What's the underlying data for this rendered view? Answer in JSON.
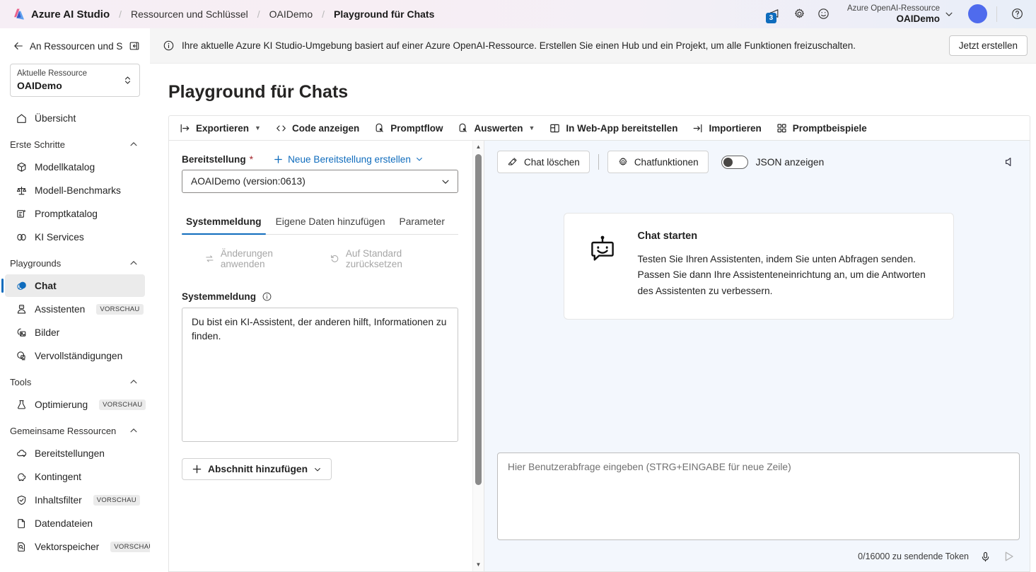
{
  "header": {
    "brand": "Azure AI Studio",
    "breadcrumbs": [
      "Ressourcen und Schlüssel",
      "OAIDemo",
      "Playground für Chats"
    ],
    "notification_badge": "3",
    "resource_kind": "Azure OpenAI-Ressource",
    "resource_name": "OAIDemo",
    "icons": {
      "megaphone": "megaphone-icon",
      "gear": "gear-icon",
      "feedback": "smiley-icon",
      "chevron": "chevron-down-icon",
      "help": "help-icon"
    },
    "avatar_color": "#4f6bed"
  },
  "sidebar": {
    "collapse_label": "An Ressourcen und Sc...",
    "resource_card": {
      "label": "Aktuelle Ressource",
      "value": "OAIDemo"
    },
    "overview": {
      "label": "Übersicht",
      "icon": "home-icon"
    },
    "groups": [
      {
        "title": "Erste Schritte",
        "items": [
          {
            "label": "Modellkatalog",
            "icon": "cube-icon",
            "badge": ""
          },
          {
            "label": "Modell-Benchmarks",
            "icon": "scale-icon",
            "badge": ""
          },
          {
            "label": "Promptkatalog",
            "icon": "prompt-icon",
            "badge": ""
          },
          {
            "label": "KI Services",
            "icon": "services-icon",
            "badge": ""
          }
        ]
      },
      {
        "title": "Playgrounds",
        "items": [
          {
            "label": "Chat",
            "icon": "chat-icon",
            "badge": "",
            "active": true
          },
          {
            "label": "Assistenten",
            "icon": "assistant-icon",
            "badge": "VORSCHAU"
          },
          {
            "label": "Bilder",
            "icon": "image-icon",
            "badge": ""
          },
          {
            "label": "Vervollständigungen",
            "icon": "completions-icon",
            "badge": ""
          }
        ]
      },
      {
        "title": "Tools",
        "items": [
          {
            "label": "Optimierung",
            "icon": "flask-icon",
            "badge": "VORSCHAU"
          }
        ]
      },
      {
        "title": "Gemeinsame Ressourcen",
        "items": [
          {
            "label": "Bereitstellungen",
            "icon": "cloud-icon",
            "badge": ""
          },
          {
            "label": "Kontingent",
            "icon": "piggybank-icon",
            "badge": ""
          },
          {
            "label": "Inhaltsfilter",
            "icon": "shield-icon",
            "badge": "VORSCHAU"
          },
          {
            "label": "Datendateien",
            "icon": "file-icon",
            "badge": ""
          },
          {
            "label": "Vektorspeicher",
            "icon": "vector-icon",
            "badge": "VORSCHAU"
          }
        ]
      }
    ]
  },
  "banner": {
    "text": "Ihre aktuelle Azure KI Studio-Umgebung basiert auf einer Azure OpenAI-Ressource. Erstellen Sie einen Hub und ein Projekt, um alle Funktionen freizuschalten.",
    "button": "Jetzt erstellen",
    "icon": "info-icon"
  },
  "page": {
    "title": "Playground für Chats"
  },
  "toolbar": {
    "items": [
      {
        "label": "Exportieren",
        "icon": "export-icon",
        "chevron": true
      },
      {
        "label": "Code anzeigen",
        "icon": "code-icon",
        "chevron": false
      },
      {
        "label": "Promptflow",
        "icon": "promptflow-icon",
        "chevron": false
      },
      {
        "label": "Auswerten",
        "icon": "evaluate-icon",
        "chevron": true
      },
      {
        "label": "In Web-App bereitstellen",
        "icon": "webapp-icon",
        "chevron": false
      },
      {
        "label": "Importieren",
        "icon": "import-icon",
        "chevron": false
      },
      {
        "label": "Promptbeispiele",
        "icon": "grid-icon",
        "chevron": false
      }
    ]
  },
  "config": {
    "deployment_label": "Bereitstellung",
    "required_mark": "*",
    "new_deployment_link": "Neue Bereitstellung erstellen",
    "deployment_value": "AOAIDemo (version:0613)",
    "tabs": [
      {
        "label": "Systemmeldung",
        "active": true
      },
      {
        "label": "Eigene Daten hinzufügen",
        "active": false
      },
      {
        "label": "Parameter",
        "active": false
      }
    ],
    "actions": [
      {
        "label": "Änderungen anwenden",
        "icon": "apply-icon",
        "disabled": true
      },
      {
        "label": "Auf Standard zurücksetzen",
        "icon": "reset-icon",
        "disabled": true
      }
    ],
    "system_message_label": "Systemmeldung",
    "system_message_value": "Du bist ein KI-Assistent, der anderen hilft, Informationen zu finden.",
    "add_section_label": "Abschnitt hinzufügen"
  },
  "chat": {
    "clear_button": "Chat löschen",
    "functions_button": "Chatfunktionen",
    "json_toggle_label": "JSON anzeigen",
    "json_toggle_on": false,
    "speaker_icon": "speaker-icon",
    "start_card": {
      "title": "Chat starten",
      "text": "Testen Sie Ihren Assistenten, indem Sie unten Abfragen senden. Passen Sie dann Ihre Assistenteneinrichtung an, um die Antworten des Assistenten zu verbessern.",
      "icon": "robot-icon"
    },
    "composer_placeholder": "Hier Benutzerabfrage eingeben (STRG+EINGABE für neue Zeile)",
    "composer_value": "",
    "token_count": "0/16000 zu sendende Token",
    "mic_icon": "microphone-icon",
    "send_icon": "send-icon"
  },
  "colors": {
    "accent": "#0f6cbd",
    "required": "#a4262c",
    "chat_bg": "#f3f7fd"
  }
}
